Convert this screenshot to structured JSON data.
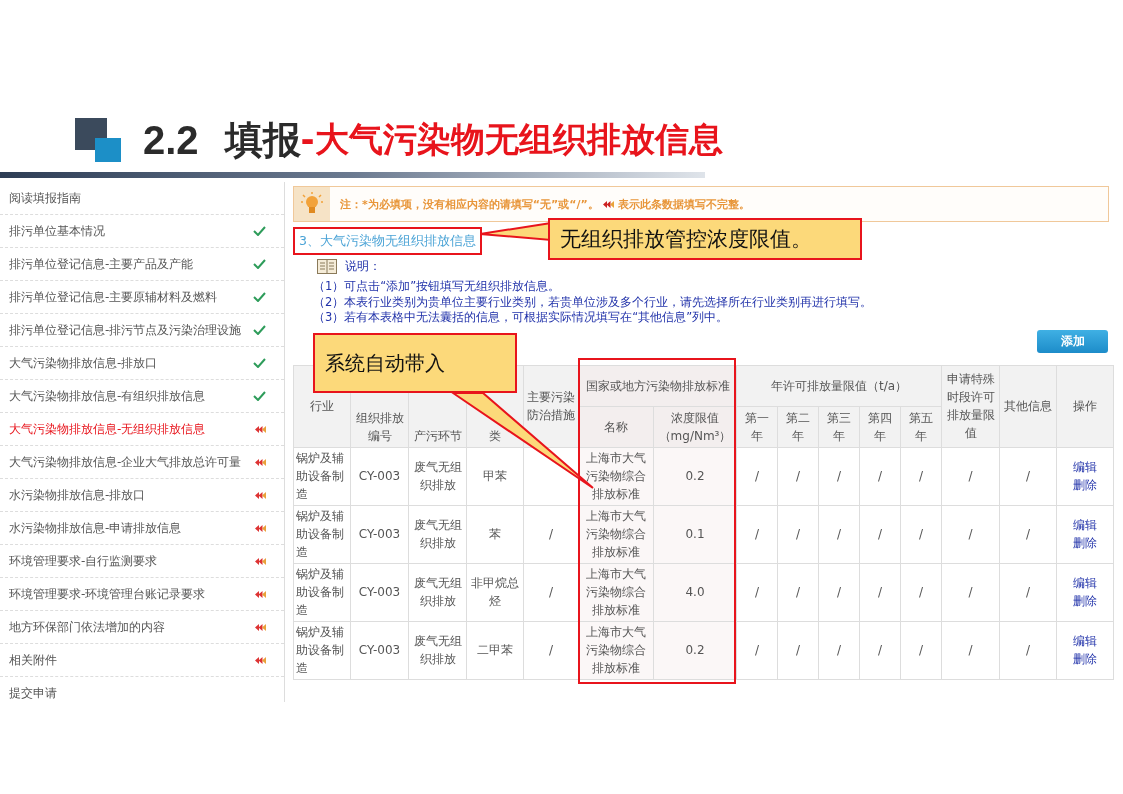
{
  "slide": {
    "number": "2.2",
    "title": "填报",
    "subtitle": "-大气污染物无组织排放信息"
  },
  "sidebar": {
    "items": [
      {
        "label": "阅读填报指南",
        "selected": false
      },
      {
        "label": "排污单位基本情况",
        "complete": true,
        "selected": false
      },
      {
        "label": "排污单位登记信息-主要产品及产能",
        "complete": true,
        "selected": false
      },
      {
        "label": "排污单位登记信息-主要原辅材料及燃料",
        "complete": true,
        "selected": false
      },
      {
        "label": "排污单位登记信息-排污节点及污染治理设施",
        "complete": true,
        "selected": false
      },
      {
        "label": "大气污染物排放信息-排放口",
        "complete": true,
        "selected": false
      },
      {
        "label": "大气污染物排放信息-有组织排放信息",
        "complete": true,
        "selected": false
      },
      {
        "label": "大气污染物排放信息-无组织排放信息",
        "complete": false,
        "selected": true
      },
      {
        "label": "大气污染物排放信息-企业大气排放总许可量",
        "complete": false,
        "selected": false
      },
      {
        "label": "水污染物排放信息-排放口",
        "complete": false,
        "selected": false
      },
      {
        "label": "水污染物排放信息-申请排放信息",
        "complete": false,
        "selected": false
      },
      {
        "label": "环境管理要求-自行监测要求",
        "complete": false,
        "selected": false
      },
      {
        "label": "环境管理要求-环境管理台账记录要求",
        "complete": false,
        "selected": false
      },
      {
        "label": "地方环保部门依法增加的内容",
        "complete": false,
        "selected": false
      },
      {
        "label": "相关附件",
        "complete": false,
        "selected": false
      },
      {
        "label": "提交申请",
        "selected": false
      }
    ]
  },
  "notice": {
    "before": "注：*为必填项，没有相应内容的请填写“无”或“/”。",
    "after": "表示此条数据填写不完整。"
  },
  "section_title": "3、大气污染物无组织排放信息",
  "instructions": {
    "heading": "说明：",
    "items": [
      "（1）可点击“添加”按钮填写无组织排放信息。",
      "（2）本表行业类别为贵单位主要行业类别，若贵单位涉及多个行业，请先选择所在行业类别再进行填写。",
      "（3）若有本表格中无法囊括的信息，可根据实际情况填写在“其他信息”列中。"
    ]
  },
  "add_button": "添加",
  "table": {
    "columns": [
      "行业",
      "组织排放编号",
      "产污环节",
      "类",
      "主要污染防治措施"
    ],
    "standard_group": "国家或地方污染物排放标准",
    "standard_columns": [
      "名称",
      "浓度限值（mg/Nm³）"
    ],
    "yearly_group": "年许可排放量限值（t/a）",
    "yearly_columns": [
      "第一年",
      "第二年",
      "第三年",
      "第四年",
      "第五年"
    ],
    "tail_columns": [
      "申请特殊时段许可排放量限值",
      "其他信息",
      "操作"
    ],
    "rows": [
      {
        "industry": "锅炉及辅助设备制造",
        "code": "CY-003",
        "source": "废气无组织排放",
        "pollutant": "甲苯",
        "standard": "上海市大气污染物综合排放标准",
        "limit": "0.2",
        "years": [
          "/",
          "/",
          "/",
          "/",
          "/"
        ],
        "special": "/",
        "other": "/",
        "actions": [
          "编辑",
          "删除"
        ]
      },
      {
        "industry": "锅炉及辅助设备制造",
        "code": "CY-003",
        "source": "废气无组织排放",
        "pollutant": "苯",
        "measures": "/",
        "standard": "上海市大气污染物综合排放标准",
        "limit": "0.1",
        "years": [
          "/",
          "/",
          "/",
          "/",
          "/"
        ],
        "special": "/",
        "other": "/",
        "actions": [
          "编辑",
          "删除"
        ]
      },
      {
        "industry": "锅炉及辅助设备制造",
        "code": "CY-003",
        "source": "废气无组织排放",
        "pollutant": "非甲烷总烃",
        "measures": "/",
        "standard": "上海市大气污染物综合排放标准",
        "limit": "4.0",
        "years": [
          "/",
          "/",
          "/",
          "/",
          "/"
        ],
        "special": "/",
        "other": "/",
        "actions": [
          "编辑",
          "删除"
        ]
      },
      {
        "industry": "锅炉及辅助设备制造",
        "code": "CY-003",
        "source": "废气无组织排放",
        "pollutant": "二甲苯",
        "measures": "/",
        "standard": "上海市大气污染物综合排放标准",
        "limit": "0.2",
        "years": [
          "/",
          "/",
          "/",
          "/",
          "/"
        ],
        "special": "/",
        "other": "/",
        "actions": [
          "编辑",
          "删除"
        ]
      }
    ]
  },
  "callouts": [
    "无组织排放管控浓度限值。",
    "系统自动带入"
  ]
}
